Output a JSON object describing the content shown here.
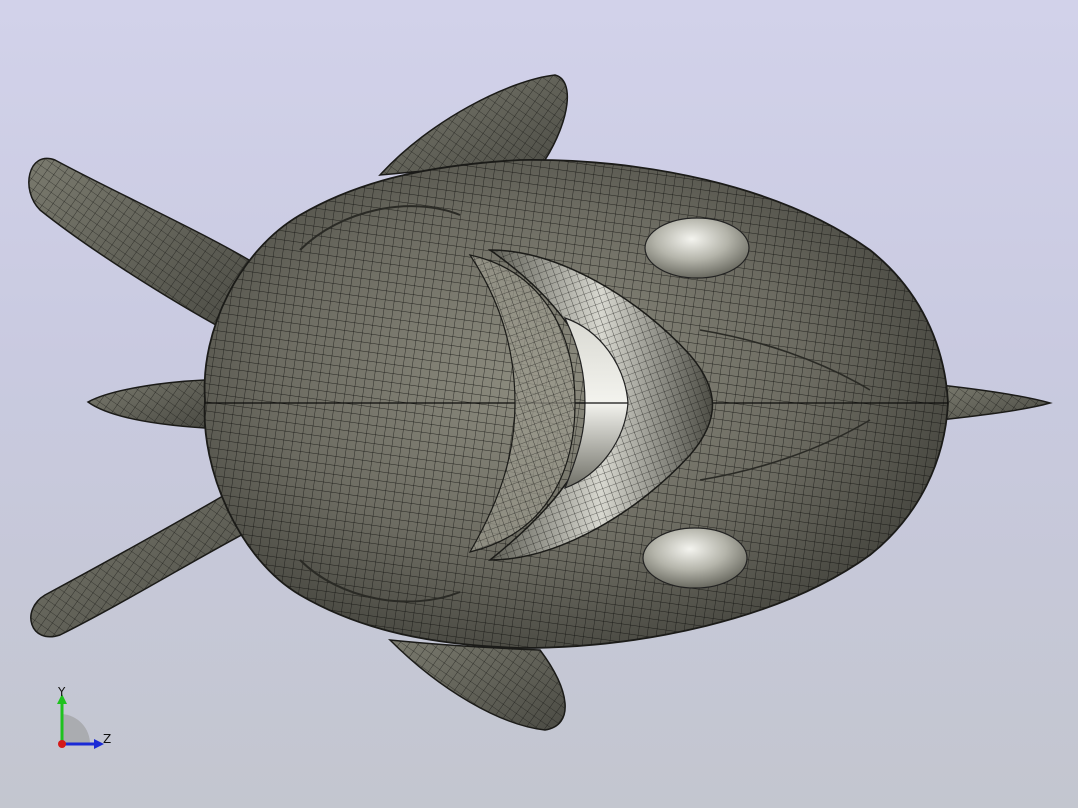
{
  "viewport": {
    "background_top": "#d2d2ea",
    "background_bottom": "#c3c6cf",
    "model_color": "#6e6e62",
    "mesh_line_color": "#0e0e0c",
    "highlight_color": "#e8e8e2"
  },
  "model": {
    "name": "fish-mesh-model",
    "view": "top"
  },
  "triad": {
    "y_label": "Y",
    "z_label": "Z",
    "y_color": "#1ec21e",
    "z_color": "#1a2ad6",
    "x_color": "#d41a1a"
  }
}
